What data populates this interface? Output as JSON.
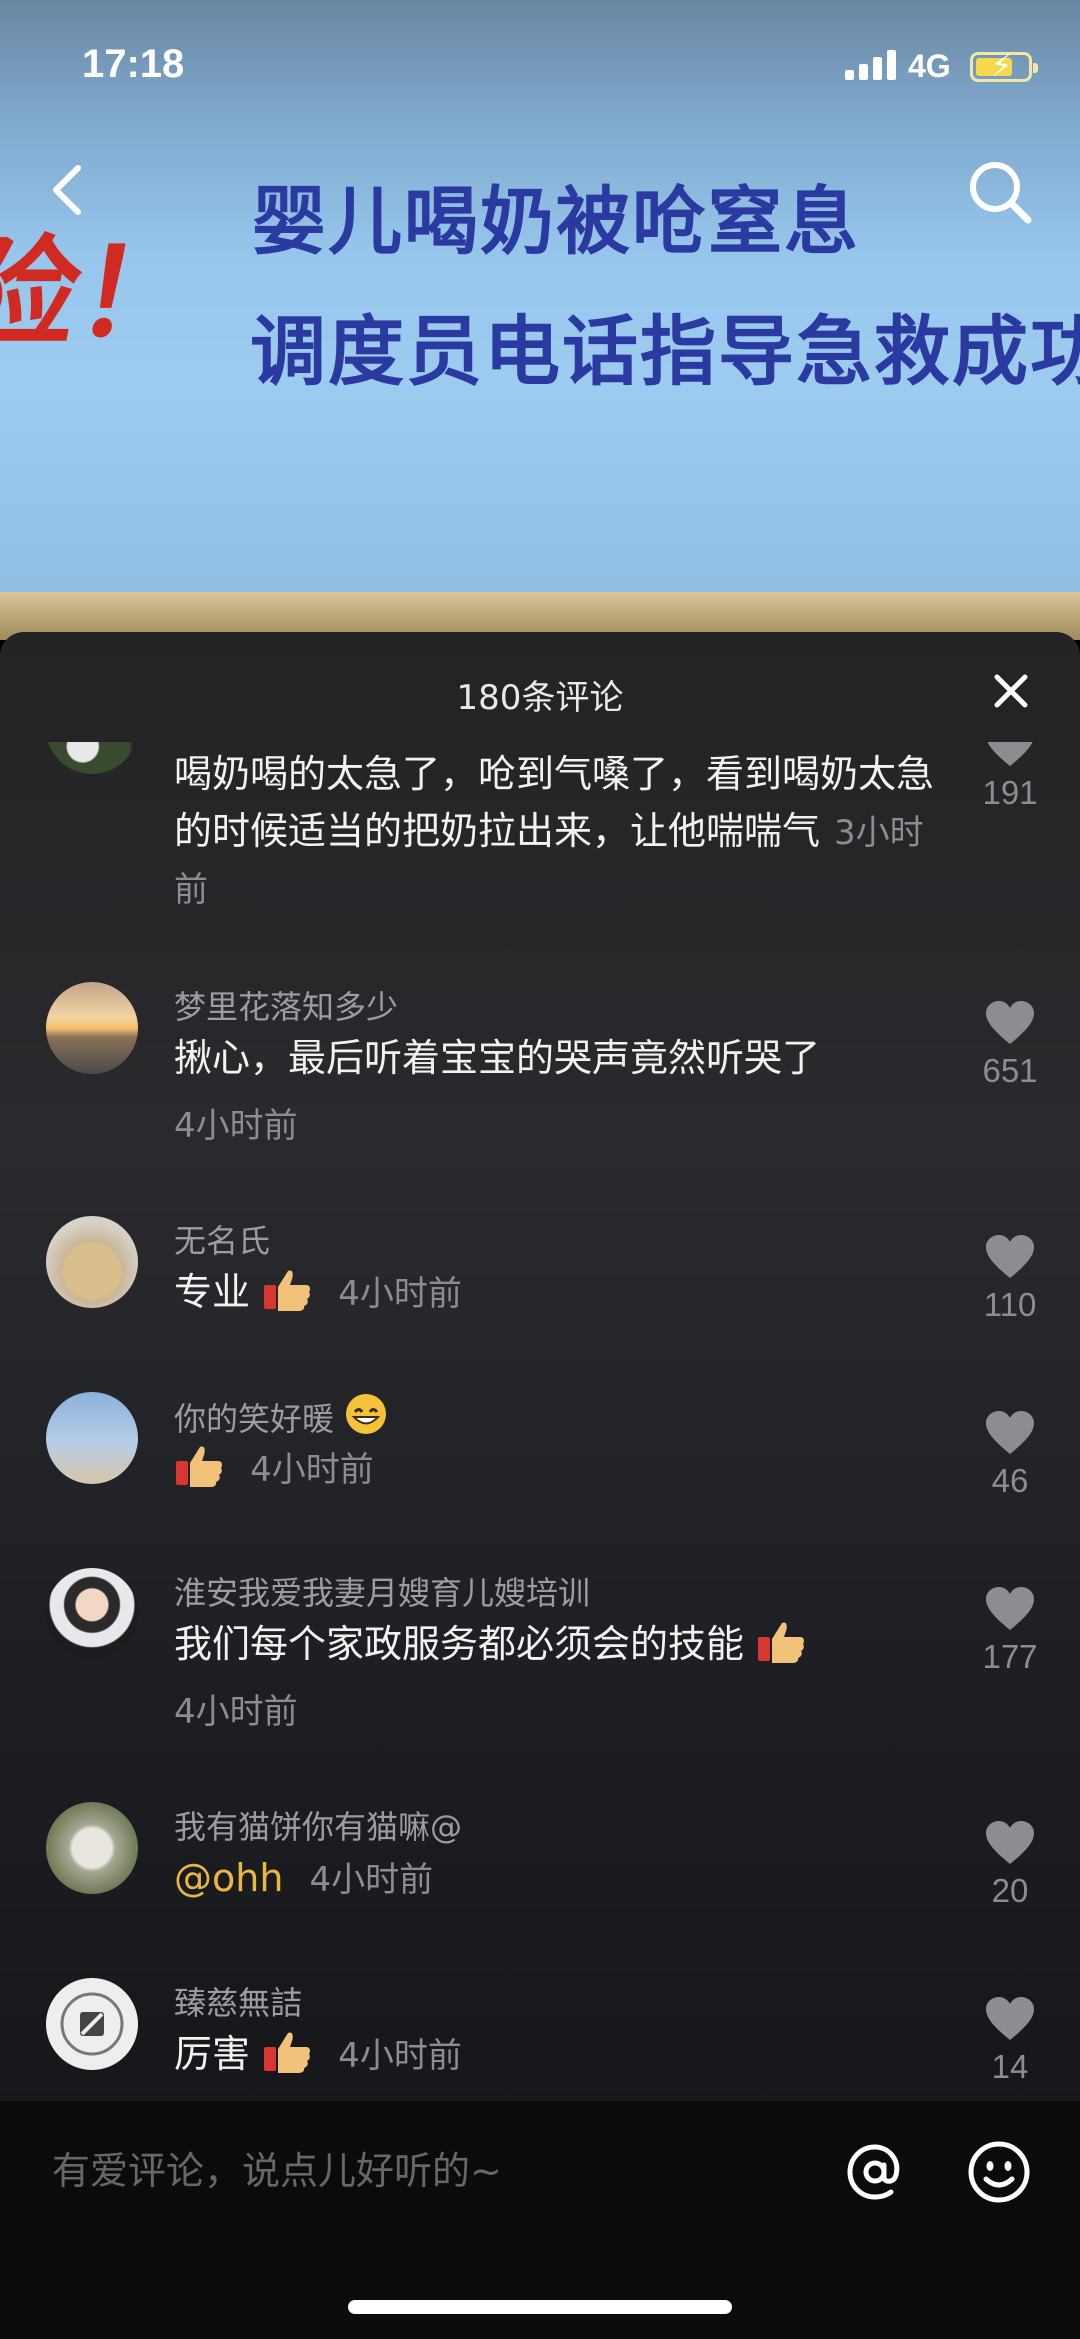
{
  "status_bar": {
    "time": "17:18",
    "network": "4G"
  },
  "video": {
    "headline_line1": "婴儿喝奶被呛窒息",
    "headline_line2": "调度员电话指导急救成功",
    "red_char": "险！"
  },
  "panel": {
    "title": "180条评论",
    "comments": [
      {
        "user": "",
        "text": "喝奶喝的太急了，呛到气嗓了，看到喝奶太急的时候适当的把奶拉出来，让他喘喘气",
        "time": "3小时前",
        "likes": "191"
      },
      {
        "user": "梦里花落知多少",
        "text": "揪心，最后听着宝宝的哭声竟然听哭了",
        "time": "4小时前",
        "likes": "651"
      },
      {
        "user": "无名氏",
        "text": "专业",
        "time": "4小时前",
        "likes": "110"
      },
      {
        "user": "你的笑好暖",
        "text": "",
        "time": "4小时前",
        "likes": "46"
      },
      {
        "user": "淮安我爱我妻月嫂育儿嫂培训",
        "text": "我们每个家政服务都必须会的技能",
        "time": "4小时前",
        "likes": "177"
      },
      {
        "user": "我有猫饼你有猫嘛@",
        "text": "@ohh",
        "time": "4小时前",
        "likes": "20"
      },
      {
        "user": "臻慈無詰",
        "text": "厉害",
        "time": "4小时前",
        "likes": "14"
      }
    ]
  },
  "input": {
    "placeholder": "有爱评论，说点儿好听的~"
  },
  "colors": {
    "mention": "#e9b643",
    "panel_bg": "#232325",
    "headline": "#2b3aa0"
  }
}
